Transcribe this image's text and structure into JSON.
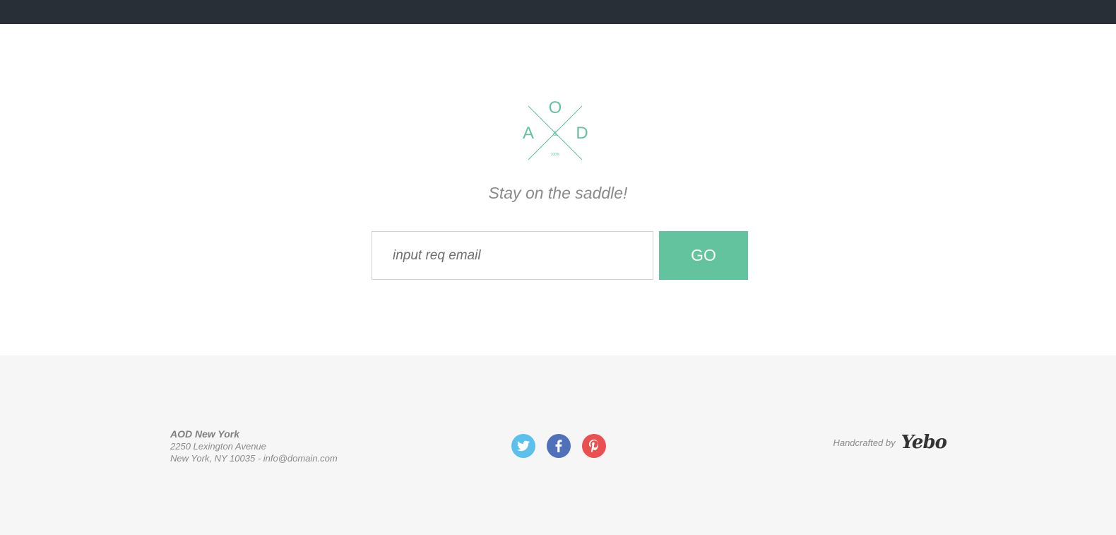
{
  "logo": {
    "letter_top": "O",
    "letter_left": "A",
    "letter_right": "D",
    "ampersand": "&",
    "caption": "100%",
    "color": "#63c39e"
  },
  "hero": {
    "tagline": "Stay on the saddle!"
  },
  "subscribe": {
    "email_placeholder": "input req email",
    "email_value": "",
    "button_label": "GO",
    "button_color": "#63c39e"
  },
  "footer": {
    "company": "AOD New York",
    "address_line1": "2250 Lexington Avenue",
    "address_line2": "New York, NY 10035 - info@domain.com",
    "social": [
      {
        "name": "twitter-icon",
        "color": "#5bc0eb"
      },
      {
        "name": "facebook-icon",
        "color": "#4e71ba"
      },
      {
        "name": "pinterest-icon",
        "color": "#e9504f"
      }
    ],
    "credit_label": "Handcrafted by",
    "credit_brand": "Yebo"
  },
  "colors": {
    "topbar": "#282f37",
    "footer_bg": "#f6f6f6",
    "text_muted": "#8a8a8a"
  }
}
